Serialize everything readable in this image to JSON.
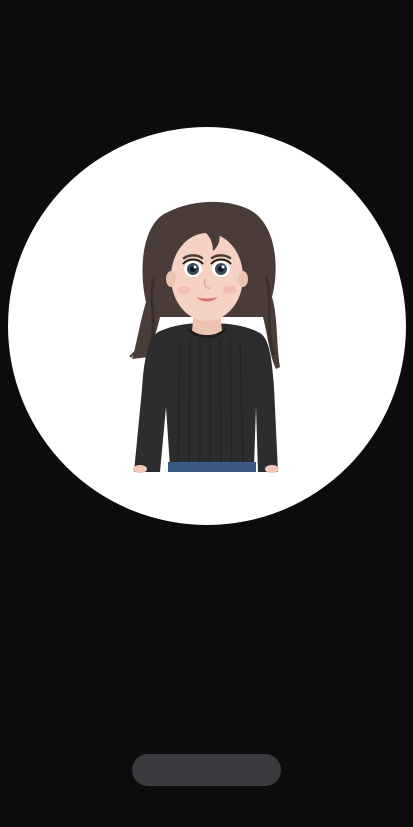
{
  "avatar": {
    "description_icon": "avatar-figure-icon"
  },
  "info": {
    "title": "",
    "body": ""
  },
  "actions": {
    "next_label": ""
  },
  "colors": {
    "background": "#0c0c0d",
    "circle": "#ffffff",
    "button": "#3b3b3f"
  }
}
